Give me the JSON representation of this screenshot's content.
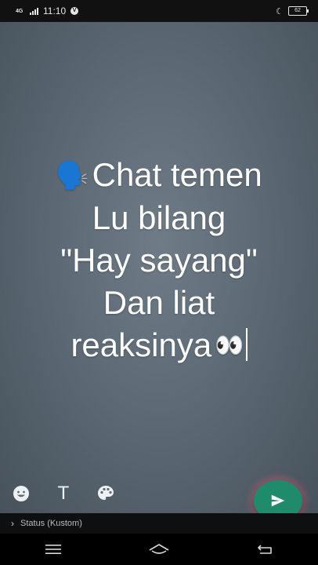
{
  "status_bar": {
    "network": "4G",
    "time": "11:10",
    "vpn_label": "V",
    "battery": "62"
  },
  "message": {
    "line1": "Chat temen",
    "line2": "Lu bilang",
    "line3": "\"Hay sayang\"",
    "line4": "Dan liat",
    "line5": "reaksinya",
    "speaker_emoji": "🗣️",
    "eyes_emoji": "👀"
  },
  "tools": {
    "text_label": "T"
  },
  "audience": {
    "label": "Status (Kustom)"
  },
  "icons": {
    "emoji": "emoji-icon",
    "text": "text-icon",
    "palette": "palette-icon",
    "send": "send-icon",
    "menu": "menu-icon",
    "home": "home-icon",
    "back": "back-icon"
  },
  "colors": {
    "send_button": "#1f8a6c",
    "canvas": "#5d6974"
  }
}
